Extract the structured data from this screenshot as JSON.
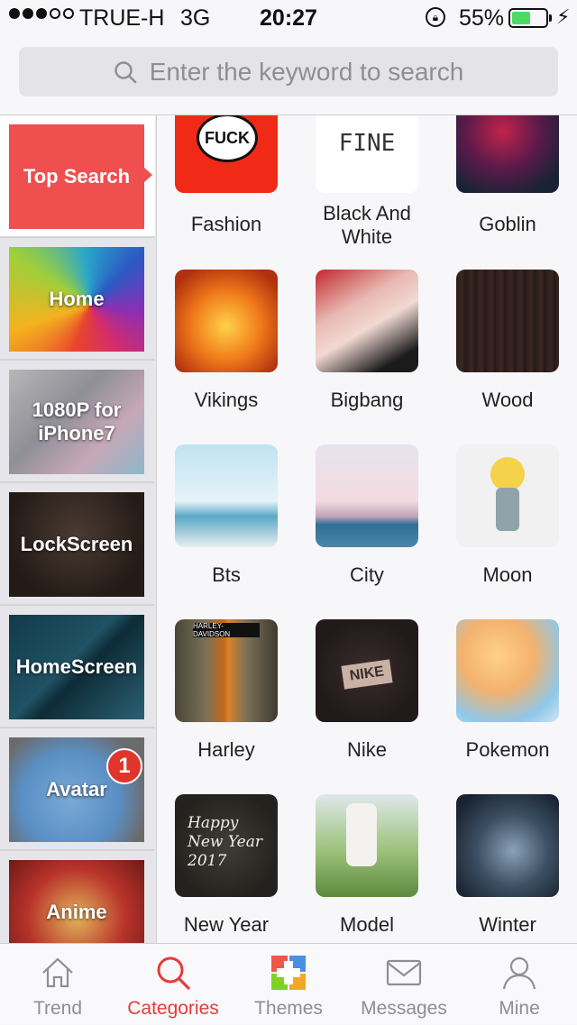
{
  "status": {
    "carrier": "TRUE-H",
    "network": "3G",
    "time": "20:27",
    "battery": "55%",
    "battery_level": 0.55
  },
  "search": {
    "placeholder": "Enter the keyword to search",
    "icon": "search-icon"
  },
  "sidebar": {
    "items": [
      {
        "label": "Top Search",
        "selected": true
      },
      {
        "label": "Home"
      },
      {
        "label": "1080P for iPhone7"
      },
      {
        "label": "LockScreen"
      },
      {
        "label": "HomeScreen"
      },
      {
        "label": "Avatar",
        "badge": "1"
      },
      {
        "label": "Anime"
      }
    ]
  },
  "thumb_text": {
    "fashion": "FUCK",
    "black_white": "FINE",
    "harley": "HARLEY-DAVIDSON",
    "nike": "NIKE",
    "new_year": "Happy New Year 2017"
  },
  "grid": {
    "items": [
      {
        "label": "Fashion"
      },
      {
        "label": "Black And White"
      },
      {
        "label": "Goblin"
      },
      {
        "label": "Vikings"
      },
      {
        "label": "Bigbang"
      },
      {
        "label": "Wood"
      },
      {
        "label": "Bts"
      },
      {
        "label": "City"
      },
      {
        "label": "Moon"
      },
      {
        "label": "Harley"
      },
      {
        "label": "Nike"
      },
      {
        "label": "Pokemon"
      },
      {
        "label": "New Year"
      },
      {
        "label": "Model"
      },
      {
        "label": "Winter"
      }
    ]
  },
  "tabbar": {
    "items": [
      {
        "label": "Trend",
        "icon": "home-icon"
      },
      {
        "label": "Categories",
        "icon": "search-icon",
        "active": true
      },
      {
        "label": "Themes",
        "icon": "themes-icon"
      },
      {
        "label": "Messages",
        "icon": "envelope-icon"
      },
      {
        "label": "Mine",
        "icon": "user-icon"
      }
    ]
  },
  "colors": {
    "accent": "#e53b3b",
    "selected_category": "#ef4f4f",
    "battery": "#4cd964"
  }
}
